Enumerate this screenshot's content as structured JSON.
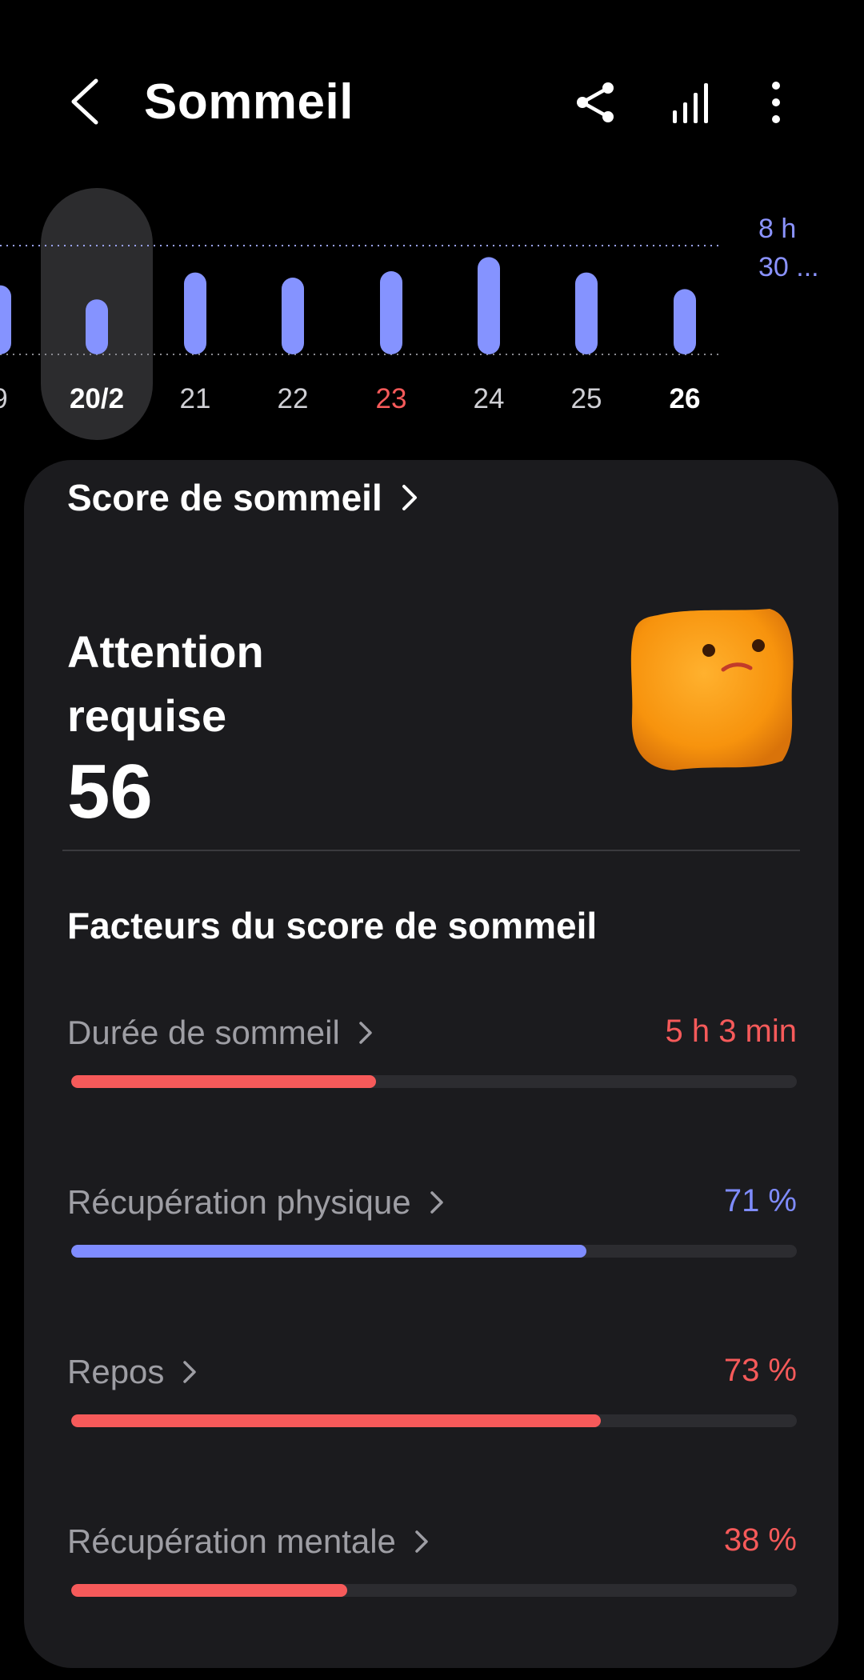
{
  "header": {
    "title": "Sommeil"
  },
  "week": {
    "goal_label_line1": "8 h",
    "goal_label_line2": "30 ...",
    "days": [
      {
        "label": "9",
        "sleep_hours": 5.4,
        "style": "normal"
      },
      {
        "label": "20/2",
        "sleep_hours": 4.3,
        "style": "selected"
      },
      {
        "label": "21",
        "sleep_hours": 6.4,
        "style": "normal"
      },
      {
        "label": "22",
        "sleep_hours": 6.0,
        "style": "normal"
      },
      {
        "label": "23",
        "sleep_hours": 6.5,
        "style": "weekend"
      },
      {
        "label": "24",
        "sleep_hours": 7.6,
        "style": "normal"
      },
      {
        "label": "25",
        "sleep_hours": 6.4,
        "style": "normal"
      },
      {
        "label": "26",
        "sleep_hours": 5.1,
        "style": "today"
      }
    ]
  },
  "card": {
    "link_label": "Score de sommeil",
    "status_line1": "Attention",
    "status_line2": "requise",
    "score": "56",
    "factors_title": "Facteurs du score de sommeil",
    "factors": [
      {
        "label": "Durée de sommeil",
        "value": "5 h 3 min",
        "fill": 0.42,
        "color": "#f65a5a"
      },
      {
        "label": "Récupération physique",
        "value": "71 %",
        "fill": 0.71,
        "color": "#7f8cff"
      },
      {
        "label": "Repos",
        "value": "73 %",
        "fill": 0.73,
        "color": "#f65a5a"
      },
      {
        "label": "Récupération mentale",
        "value": "38 %",
        "fill": 0.38,
        "color": "#f65a5a"
      }
    ]
  },
  "colors": {
    "bar": "#8593ff",
    "alert": "#f65a5a",
    "accent_blue": "#7f8cff"
  },
  "icons": [
    "back-arrow-icon",
    "share-icon",
    "stats-bars-icon",
    "more-vertical-icon",
    "chevron-right-icon",
    "mascot-image"
  ]
}
